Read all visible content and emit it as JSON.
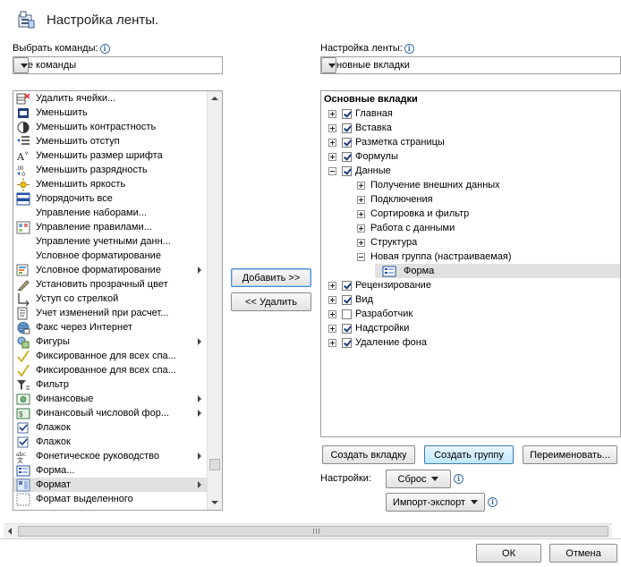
{
  "title": "Настройка ленты.",
  "left": {
    "label": "Выбрать команды:",
    "combo_value": "Все команды",
    "commands": [
      {
        "label": "Удалить ячейки...",
        "icon": "delete-cells-icon",
        "submenu": false
      },
      {
        "label": "Уменьшить",
        "icon": "shrink-icon",
        "submenu": false
      },
      {
        "label": "Уменьшить контрастность",
        "icon": "contrast-icon",
        "submenu": false
      },
      {
        "label": "Уменьшить отступ",
        "icon": "decrease-indent-icon",
        "submenu": false
      },
      {
        "label": "Уменьшить размер шрифта",
        "icon": "decrease-font-size-icon",
        "submenu": false
      },
      {
        "label": "Уменьшить разрядность",
        "icon": "decrease-decimal-icon",
        "submenu": false
      },
      {
        "label": "Уменьшить яркость",
        "icon": "brightness-icon",
        "submenu": false
      },
      {
        "label": "Упорядочить все",
        "icon": "arrange-all-icon",
        "submenu": false
      },
      {
        "label": "Управление наборами...",
        "icon": "",
        "submenu": false
      },
      {
        "label": "Управление правилами...",
        "icon": "manage-rules-icon",
        "submenu": false
      },
      {
        "label": "Управление учетными данн...",
        "icon": "",
        "submenu": false
      },
      {
        "label": "Условное форматирование",
        "icon": "",
        "submenu": false
      },
      {
        "label": "Условное форматирование",
        "icon": "conditional-format-icon",
        "submenu": true
      },
      {
        "label": "Установить прозрачный цвет",
        "icon": "transparent-color-icon",
        "submenu": false
      },
      {
        "label": "Уступ со стрелкой",
        "icon": "elbow-arrow-icon",
        "submenu": false
      },
      {
        "label": "Учет изменений при расчет...",
        "icon": "track-changes-icon",
        "submenu": false
      },
      {
        "label": "Факс через Интернет",
        "icon": "fax-icon",
        "submenu": false
      },
      {
        "label": "Фигуры",
        "icon": "shapes-icon",
        "submenu": true
      },
      {
        "label": "Фиксированное для всех спа...",
        "icon": "checkmark-icon",
        "submenu": false
      },
      {
        "label": "Фиксированное для всех спа...",
        "icon": "checkmark-icon",
        "submenu": false
      },
      {
        "label": "Фильтр",
        "icon": "filter-icon",
        "submenu": false
      },
      {
        "label": "Финансовые",
        "icon": "financial-icon",
        "submenu": true
      },
      {
        "label": "Финансовый числовой фор...",
        "icon": "financial-format-icon",
        "submenu": true
      },
      {
        "label": "Флажок",
        "icon": "checkbox-icon",
        "submenu": false
      },
      {
        "label": "Флажок",
        "icon": "checkbox-icon",
        "submenu": false
      },
      {
        "label": "Фонетическое руководство",
        "icon": "phonetic-icon",
        "submenu": true
      },
      {
        "label": "Форма...",
        "icon": "form-icon",
        "submenu": false
      },
      {
        "label": "Формат",
        "icon": "format-icon",
        "submenu": true,
        "selected": true
      },
      {
        "label": "Формат выделенного",
        "icon": "format-selection-icon",
        "submenu": false
      }
    ]
  },
  "buttons": {
    "add": "Добавить >>",
    "remove": "<< Удалить"
  },
  "right": {
    "label": "Настройка ленты:",
    "combo_value": "Основные вкладки",
    "tree_header": "Основные вкладки",
    "tree": [
      {
        "label": "Главная",
        "level": 0,
        "expander": "plus",
        "checkbox": true,
        "checked": true
      },
      {
        "label": "Вставка",
        "level": 0,
        "expander": "plus",
        "checkbox": true,
        "checked": true
      },
      {
        "label": "Разметка страницы",
        "level": 0,
        "expander": "plus",
        "checkbox": true,
        "checked": true
      },
      {
        "label": "Формулы",
        "level": 0,
        "expander": "plus",
        "checkbox": true,
        "checked": true
      },
      {
        "label": "Данные",
        "level": 0,
        "expander": "minus",
        "checkbox": true,
        "checked": true
      },
      {
        "label": "Получение внешних данных",
        "level": 1,
        "expander": "plus",
        "checkbox": false
      },
      {
        "label": "Подключения",
        "level": 1,
        "expander": "plus",
        "checkbox": false
      },
      {
        "label": "Сортировка и фильтр",
        "level": 1,
        "expander": "plus",
        "checkbox": false
      },
      {
        "label": "Работа с данными",
        "level": 1,
        "expander": "plus",
        "checkbox": false
      },
      {
        "label": "Структура",
        "level": 1,
        "expander": "plus",
        "checkbox": false
      },
      {
        "label": "Новая группа (настраиваемая)",
        "level": 1,
        "expander": "minus",
        "checkbox": false
      },
      {
        "label": "Форма",
        "level": 2,
        "expander": "none",
        "checkbox": false,
        "icon": "form-icon",
        "selected": true
      },
      {
        "label": "Рецензирование",
        "level": 0,
        "expander": "plus",
        "checkbox": true,
        "checked": true
      },
      {
        "label": "Вид",
        "level": 0,
        "expander": "plus",
        "checkbox": true,
        "checked": true
      },
      {
        "label": "Разработчик",
        "level": 0,
        "expander": "plus",
        "checkbox": true,
        "checked": false
      },
      {
        "label": "Надстройки",
        "level": 0,
        "expander": "plus",
        "checkbox": true,
        "checked": true
      },
      {
        "label": "Удаление фона",
        "level": 0,
        "expander": "plus",
        "checkbox": true,
        "checked": true
      }
    ],
    "new_tab": "Создать вкладку",
    "new_group": "Создать группу",
    "rename": "Переименовать...",
    "settings_label": "Настройки:",
    "reset": "Сброс",
    "import_export": "Импорт-экспорт"
  },
  "footer": {
    "ok": "ОК",
    "cancel": "Отмена"
  }
}
